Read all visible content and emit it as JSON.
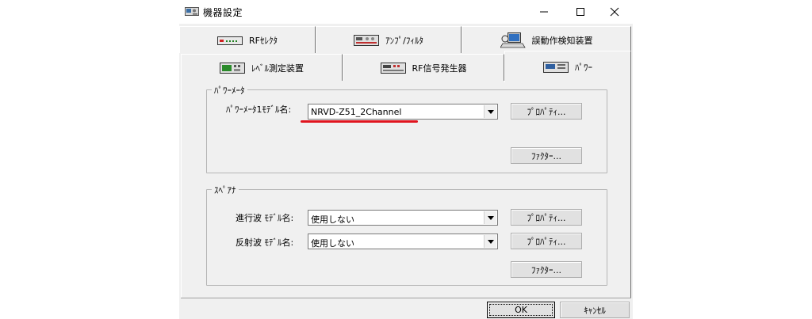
{
  "window": {
    "title": "機器設定"
  },
  "tabs_row1": [
    {
      "label": "RFｾﾚｸﾀ",
      "icon": "rf-selector-device-icon"
    },
    {
      "label": "ｱﾝﾌﾟ/ﾌｨﾙﾀ",
      "icon": "amp-filter-device-icon"
    },
    {
      "label": "誤動作検知装置",
      "icon": "malfunction-detector-computer-icon"
    }
  ],
  "tabs_row2": [
    {
      "label": "ﾚﾍﾞﾙ測定装置",
      "icon": "level-meter-device-icon"
    },
    {
      "label": "RF信号発生器",
      "icon": "signal-generator-device-icon"
    },
    {
      "label": "ﾊﾟﾜｰ",
      "icon": "power-meter-device-icon",
      "active": true
    }
  ],
  "power_meter": {
    "group_title": "ﾊﾟﾜｰﾒｰﾀ",
    "model_label": "ﾊﾟﾜｰﾒｰﾀ1ﾓﾃﾞﾙ名:",
    "model_value": "NRVD-Z51_2Channel",
    "property_button": "ﾌﾟﾛﾊﾟﾃｨ...",
    "factor_button": "ﾌｧｸﾀｰ..."
  },
  "spectrum": {
    "group_title": "ｽﾍﾟｱﾅ",
    "forward_label": "進行波 ﾓﾃﾞﾙ名:",
    "forward_value": "使用しない",
    "forward_property_button": "ﾌﾟﾛﾊﾟﾃｨ...",
    "reflected_label": "反射波 ﾓﾃﾞﾙ名:",
    "reflected_value": "使用しない",
    "reflected_property_button": "ﾌﾟﾛﾊﾟﾃｨ...",
    "factor_button": "ﾌｧｸﾀｰ..."
  },
  "footer": {
    "ok": "OK",
    "cancel": "ｷｬﾝｾﾙ"
  },
  "colors": {
    "highlight_underline": "#e0141e",
    "dialog_bg": "#f0f0f0"
  }
}
